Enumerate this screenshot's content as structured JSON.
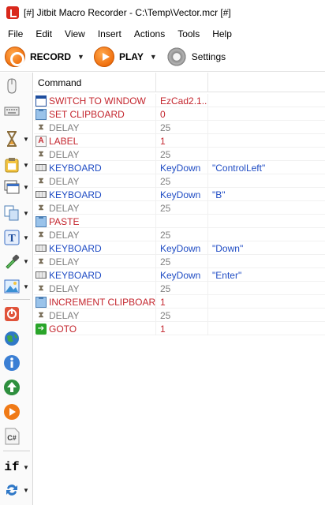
{
  "window": {
    "title": "[#] Jitbit Macro Recorder - C:\\Temp\\Vector.mcr [#]"
  },
  "menu": [
    "File",
    "Edit",
    "View",
    "Insert",
    "Actions",
    "Tools",
    "Help"
  ],
  "toolbar": {
    "record_label": "RECORD",
    "play_label": "PLAY",
    "settings_label": "Settings",
    "caret": "▼"
  },
  "sidebar": {
    "icons": [
      "mouse-icon",
      "keyboard-icon",
      "delay-icon",
      "clipboard-icon",
      "window-icon",
      "copy-icon",
      "text-icon",
      "eyedropper-icon",
      "image-icon",
      "stop-icon",
      "web-icon",
      "info-icon",
      "run-program-icon",
      "play-macro-icon",
      "csharp-icon",
      "if-icon",
      "loop-icon"
    ],
    "if_text": "if",
    "cs_text": "C#"
  },
  "grid": {
    "headers": {
      "command": "Command",
      "param1": "",
      "param2": ""
    },
    "rows": [
      {
        "icon": "window-icon",
        "command": "SWITCH TO WINDOW",
        "p1": "EzCad2.1...",
        "p2": "",
        "color": "#c4262e"
      },
      {
        "icon": "clipboard-icon",
        "command": "SET CLIPBOARD",
        "p1": "0",
        "p2": "",
        "color": "#c4262e"
      },
      {
        "icon": "delay-icon",
        "command": "DELAY",
        "p1": "25",
        "p2": "",
        "color": "#808080"
      },
      {
        "icon": "label-icon",
        "command": "LABEL",
        "p1": "1",
        "p2": "",
        "color": "#c4262e"
      },
      {
        "icon": "delay-icon",
        "command": "DELAY",
        "p1": "25",
        "p2": "",
        "color": "#808080"
      },
      {
        "icon": "keyboard-icon",
        "command": "KEYBOARD",
        "p1": "KeyDown",
        "p2": "\"ControlLeft\"",
        "color": "#1f4cc4"
      },
      {
        "icon": "delay-icon",
        "command": "DELAY",
        "p1": "25",
        "p2": "",
        "color": "#808080"
      },
      {
        "icon": "keyboard-icon",
        "command": "KEYBOARD",
        "p1": "KeyDown",
        "p2": "\"B\"",
        "color": "#1f4cc4"
      },
      {
        "icon": "delay-icon",
        "command": "DELAY",
        "p1": "25",
        "p2": "",
        "color": "#808080"
      },
      {
        "icon": "paste-icon",
        "command": "PASTE",
        "p1": "",
        "p2": "",
        "color": "#c4262e"
      },
      {
        "icon": "delay-icon",
        "command": "DELAY",
        "p1": "25",
        "p2": "",
        "color": "#808080"
      },
      {
        "icon": "keyboard-icon",
        "command": "KEYBOARD",
        "p1": "KeyDown",
        "p2": "\"Down\"",
        "color": "#1f4cc4"
      },
      {
        "icon": "delay-icon",
        "command": "DELAY",
        "p1": "25",
        "p2": "",
        "color": "#808080"
      },
      {
        "icon": "keyboard-icon",
        "command": "KEYBOARD",
        "p1": "KeyDown",
        "p2": "\"Enter\"",
        "color": "#1f4cc4"
      },
      {
        "icon": "delay-icon",
        "command": "DELAY",
        "p1": "25",
        "p2": "",
        "color": "#808080"
      },
      {
        "icon": "clipboard-icon",
        "command": "INCREMENT CLIPBOARD",
        "p1": "1",
        "p2": "",
        "color": "#c4262e"
      },
      {
        "icon": "delay-icon",
        "command": "DELAY",
        "p1": "25",
        "p2": "",
        "color": "#808080"
      },
      {
        "icon": "goto-icon",
        "command": "GOTO",
        "p1": "1",
        "p2": "",
        "color": "#c4262e"
      }
    ]
  }
}
